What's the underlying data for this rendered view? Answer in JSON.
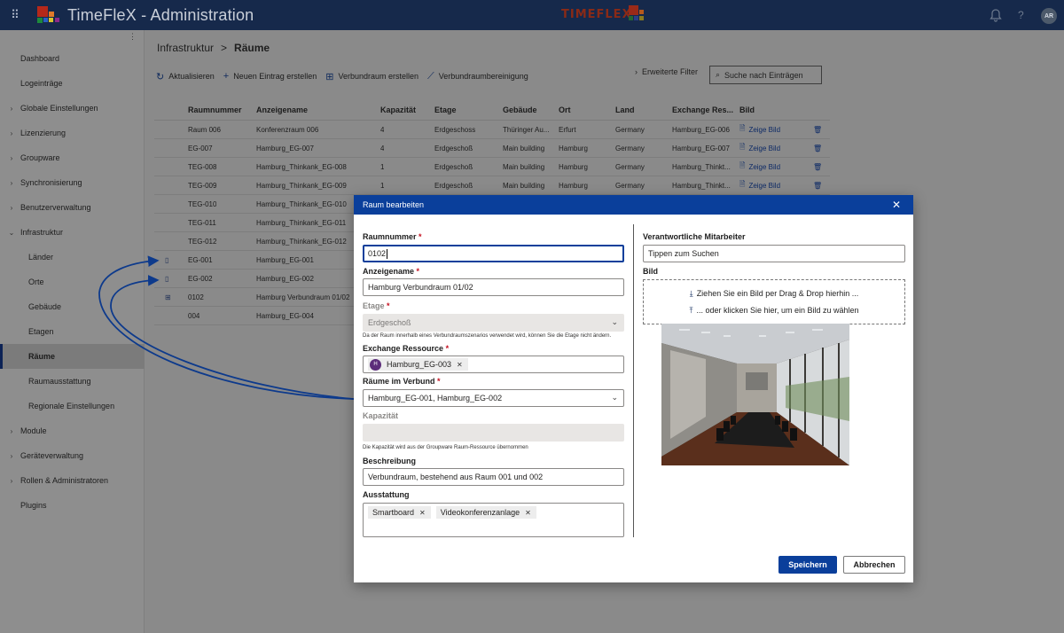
{
  "app": {
    "title": "TimeFleX - Administration",
    "brand_logo_text": "TIMEFLEX",
    "user_initials": "AR",
    "icons": {
      "launcher": "waffle-icon",
      "notifications": "bell-icon",
      "help": "help-icon"
    }
  },
  "sidebar": {
    "items": [
      {
        "label": "Dashboard",
        "level": "top",
        "chevron": false
      },
      {
        "label": "Logeinträge",
        "level": "top",
        "chevron": false
      },
      {
        "label": "Globale Einstellungen",
        "level": "top",
        "chevron": "right"
      },
      {
        "label": "Lizenzierung",
        "level": "top",
        "chevron": "right"
      },
      {
        "label": "Groupware",
        "level": "top",
        "chevron": "right"
      },
      {
        "label": "Synchronisierung",
        "level": "top",
        "chevron": "right"
      },
      {
        "label": "Benutzerverwaltung",
        "level": "top",
        "chevron": "right"
      },
      {
        "label": "Infrastruktur",
        "level": "top",
        "chevron": "down"
      },
      {
        "label": "Länder",
        "level": "sub"
      },
      {
        "label": "Orte",
        "level": "sub"
      },
      {
        "label": "Gebäude",
        "level": "sub"
      },
      {
        "label": "Etagen",
        "level": "sub"
      },
      {
        "label": "Räume",
        "level": "sub",
        "active": true
      },
      {
        "label": "Raumausstattung",
        "level": "sub"
      },
      {
        "label": "Regionale Einstellungen",
        "level": "sub"
      },
      {
        "label": "Module",
        "level": "top",
        "chevron": "right"
      },
      {
        "label": "Geräteverwaltung",
        "level": "top",
        "chevron": "right"
      },
      {
        "label": "Rollen & Administratoren",
        "level": "top",
        "chevron": "right"
      },
      {
        "label": "Plugins",
        "level": "top",
        "chevron": false
      }
    ]
  },
  "breadcrumb": {
    "parent": "Infrastruktur",
    "separator": ">",
    "current": "Räume"
  },
  "toolbar": {
    "refresh": "Aktualisieren",
    "new_entry": "Neuen Eintrag erstellen",
    "create_composite": "Verbundraum erstellen",
    "cleanup": "Verbundraumbereinigung",
    "advanced_filter": "Erweiterte Filter",
    "search_placeholder": "Suche nach Einträgen"
  },
  "table": {
    "columns": [
      "Raumnummer",
      "Anzeigename",
      "Kapazität",
      "Etage",
      "Gebäude",
      "Ort",
      "Land",
      "Exchange Res...",
      "Bild"
    ],
    "rows": [
      {
        "icon": "",
        "nr": "Raum 006",
        "name": "Konferenzraum 006",
        "cap": "4",
        "floor": "Erdgeschoss",
        "building": "Thüringer Au...",
        "city": "Erfurt",
        "country": "Germany",
        "res": "Hamburg_EG-006",
        "img": "Zeige Bild"
      },
      {
        "icon": "",
        "nr": "EG-007",
        "name": "Hamburg_EG-007",
        "cap": "4",
        "floor": "Erdgeschoß",
        "building": "Main building",
        "city": "Hamburg",
        "country": "Germany",
        "res": "Hamburg_EG-007",
        "img": "Zeige Bild"
      },
      {
        "icon": "",
        "nr": "TEG-008",
        "name": "Hamburg_Thinkank_EG-008",
        "cap": "1",
        "floor": "Erdgeschoß",
        "building": "Main building",
        "city": "Hamburg",
        "country": "Germany",
        "res": "Hamburg_Thinkt...",
        "img": "Zeige Bild"
      },
      {
        "icon": "",
        "nr": "TEG-009",
        "name": "Hamburg_Thinkank_EG-009",
        "cap": "1",
        "floor": "Erdgeschoß",
        "building": "Main building",
        "city": "Hamburg",
        "country": "Germany",
        "res": "Hamburg_Thinkt...",
        "img": "Zeige Bild"
      },
      {
        "icon": "",
        "nr": "TEG-010",
        "name": "Hamburg_Thinkank_EG-010",
        "cap": "",
        "floor": "",
        "building": "",
        "city": "",
        "country": "",
        "res": "",
        "img": ""
      },
      {
        "icon": "",
        "nr": "TEG-011",
        "name": "Hamburg_Thinkank_EG-011",
        "cap": "",
        "floor": "",
        "building": "",
        "city": "",
        "country": "",
        "res": "",
        "img": ""
      },
      {
        "icon": "",
        "nr": "TEG-012",
        "name": "Hamburg_Thinkank_EG-012",
        "cap": "",
        "floor": "",
        "building": "",
        "city": "",
        "country": "",
        "res": "",
        "img": ""
      },
      {
        "icon": "▯",
        "nr": "EG-001",
        "name": "Hamburg_EG-001",
        "cap": "",
        "floor": "",
        "building": "",
        "city": "",
        "country": "",
        "res": "",
        "img": ""
      },
      {
        "icon": "▯",
        "nr": "EG-002",
        "name": "Hamburg_EG-002",
        "cap": "",
        "floor": "",
        "building": "",
        "city": "",
        "country": "",
        "res": "",
        "img": ""
      },
      {
        "icon": "⊞",
        "nr": "0102",
        "name": "Hamburg Verbundraum 01/02",
        "cap": "",
        "floor": "",
        "building": "",
        "city": "",
        "country": "",
        "res": "",
        "img": ""
      },
      {
        "icon": "",
        "nr": "004",
        "name": "Hamburg_EG-004",
        "cap": "",
        "floor": "",
        "building": "",
        "city": "",
        "country": "",
        "res": "",
        "img": ""
      }
    ]
  },
  "dialog": {
    "title": "Raum bearbeiten",
    "room_number": {
      "label": "Raumnummer",
      "required": "*",
      "value": "0102"
    },
    "display_name": {
      "label": "Anzeigename",
      "required": "*",
      "value": "Hamburg Verbundraum 01/02"
    },
    "floor": {
      "label": "Etage",
      "required": "*",
      "value": "Erdgeschoß",
      "hint": "Da der Raum innerhalb eines Verbundraumszenarios verwendet wird, können Sie die Etage nicht ändern."
    },
    "exchange_resource": {
      "label": "Exchange Ressource",
      "required": "*",
      "chip_initial": "H",
      "chip_label": "Hamburg_EG-003"
    },
    "rooms_in_composite": {
      "label": "Räume im Verbund",
      "required": "*",
      "value": "Hamburg_EG-001, Hamburg_EG-002"
    },
    "capacity": {
      "label": "Kapazität",
      "value": "",
      "hint": "Die Kapazität wird aus der Groupware Raum-Ressource übernommen"
    },
    "description": {
      "label": "Beschreibung",
      "value": "Verbundraum, bestehend aus Raum 001 und 002"
    },
    "equipment": {
      "label": "Ausstattung",
      "items": [
        "Smartboard",
        "Videokonferenzanlage"
      ]
    },
    "responsible": {
      "label": "Verantwortliche Mitarbeiter",
      "placeholder": "Tippen zum Suchen"
    },
    "image": {
      "label": "Bild",
      "drop_line1": "Ziehen Sie ein Bild per Drag & Drop hierhin ...",
      "drop_line2": "... oder klicken Sie hier, um ein Bild zu wählen"
    },
    "save": "Speichern",
    "cancel": "Abbrechen"
  },
  "colors": {
    "accent": "#0a3f9b",
    "topbar": "#16294b",
    "arrow": "#0d3a8c",
    "required": "#c50f1f"
  }
}
